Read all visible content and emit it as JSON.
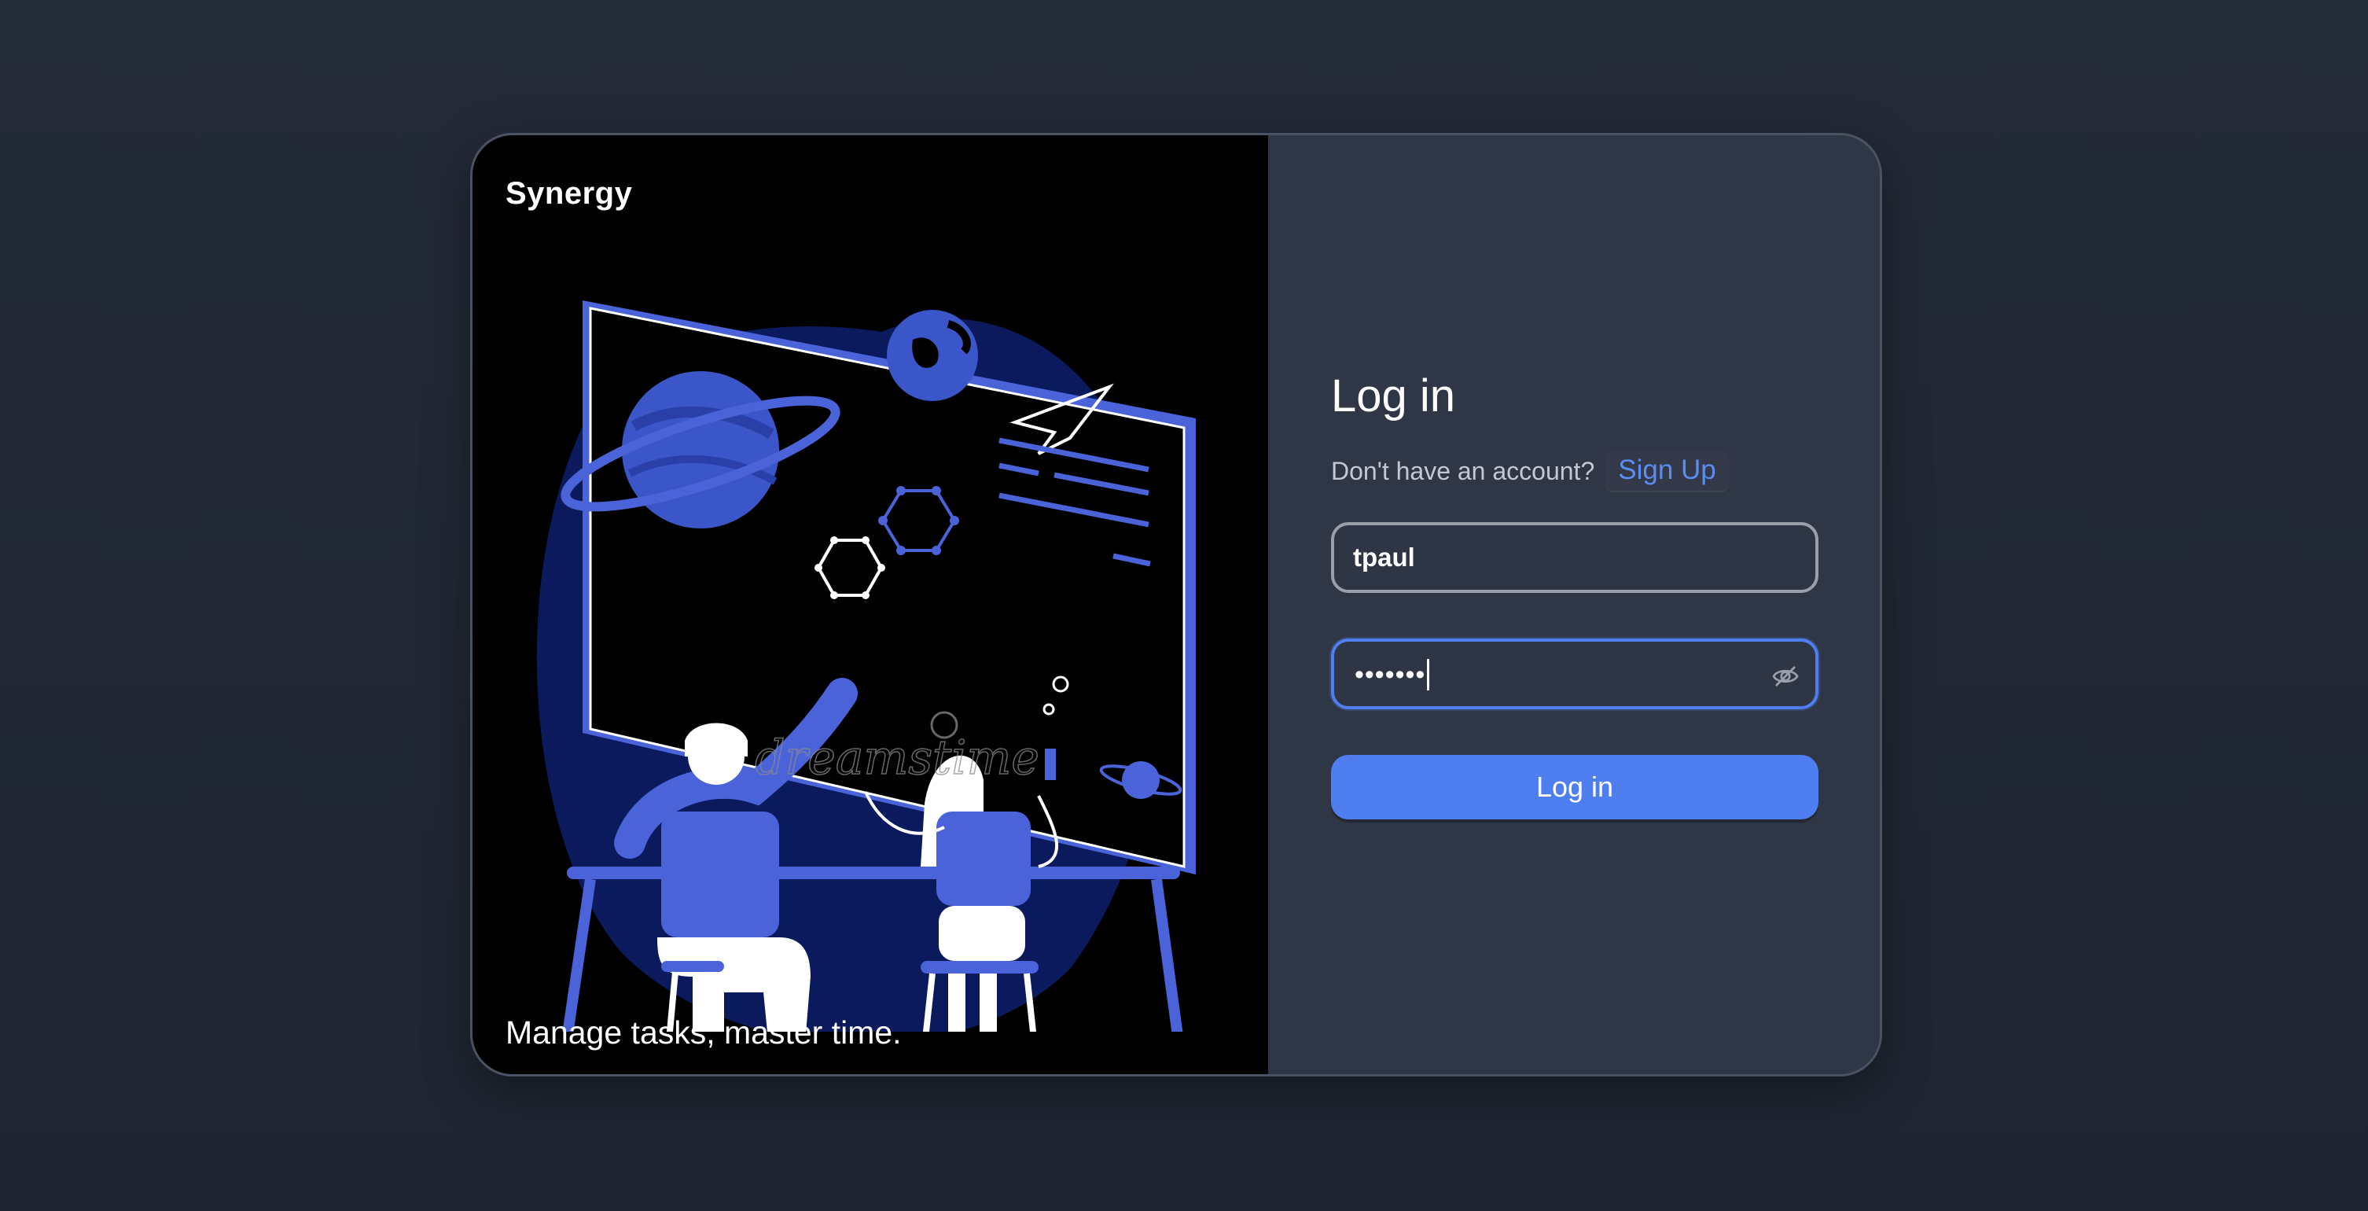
{
  "brand": {
    "name": "Synergy",
    "tagline": "Manage tasks, master time."
  },
  "login": {
    "title": "Log in",
    "prompt": "Don't have an account?",
    "signup_label": "Sign Up",
    "username_value": "tpaul",
    "password_mask": "•••••••",
    "submit_label": "Log in"
  },
  "illustration": {
    "watermark": "dreamstime"
  },
  "colors": {
    "accent": "#4f7ef0",
    "card_bg": "#2f3645",
    "page_bg": "#222836",
    "illustration_blue": "#4a63d8",
    "illustration_dark_blue": "#0a1a5c"
  }
}
